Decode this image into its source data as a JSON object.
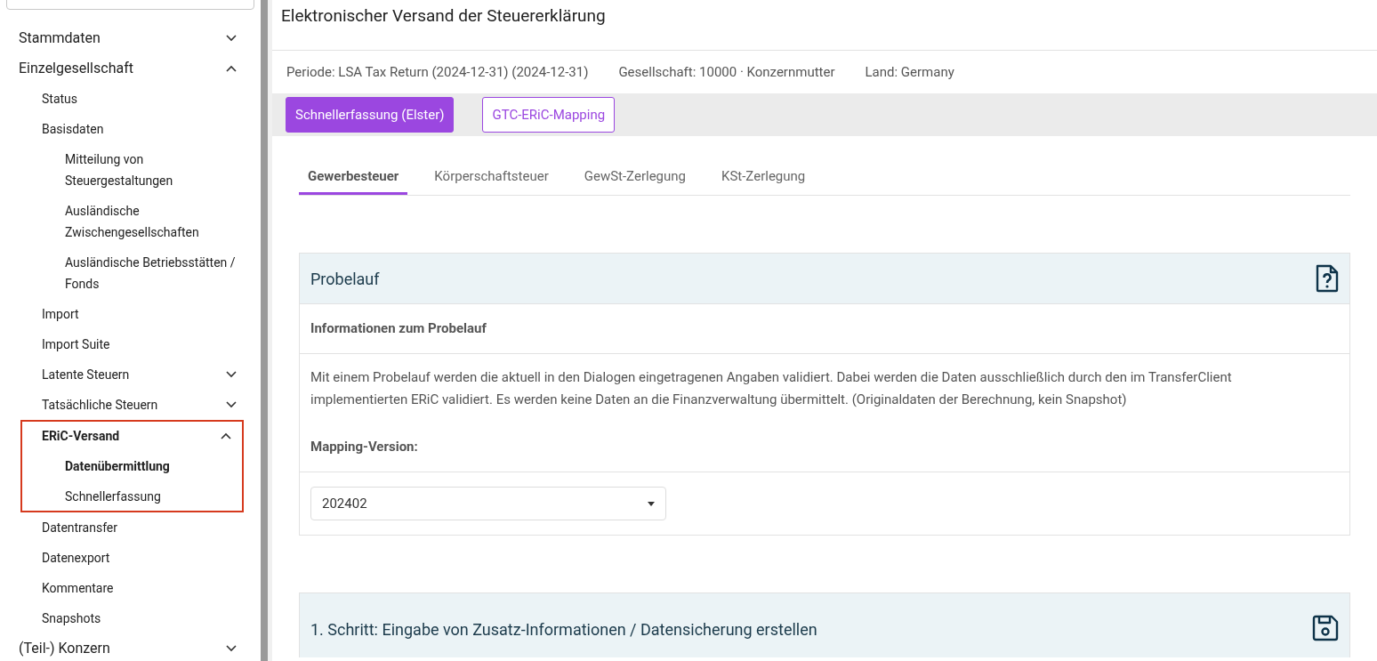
{
  "sidebar": {
    "items": [
      {
        "label": "Stammdaten",
        "expanded": false
      },
      {
        "label": "Einzelgesellschaft",
        "expanded": true,
        "children": [
          {
            "label": "Status"
          },
          {
            "label": "Basisdaten",
            "children": [
              {
                "label": "Mitteilung von Steuergestaltungen"
              },
              {
                "label": "Ausländische Zwischengesellschaften"
              },
              {
                "label": "Ausländische Betriebsstätten / Fonds"
              }
            ]
          },
          {
            "label": "Import"
          },
          {
            "label": "Import Suite"
          },
          {
            "label": "Latente Steuern",
            "expanded": false
          },
          {
            "label": "Tatsächliche Steuern",
            "expanded": false
          },
          {
            "label": "ERiC-Versand",
            "expanded": true,
            "highlighted": true,
            "children": [
              {
                "label": "Datenübermittlung",
                "selected": true
              },
              {
                "label": "Schnellerfassung",
                "selected": false
              }
            ]
          },
          {
            "label": "Datentransfer"
          },
          {
            "label": "Datenexport"
          },
          {
            "label": "Kommentare"
          },
          {
            "label": "Snapshots"
          }
        ]
      },
      {
        "label": "(Teil-) Konzern",
        "expanded": false
      }
    ]
  },
  "page": {
    "title": "Elektronischer Versand der Steuererklärung",
    "info": [
      "Periode: LSA Tax Return (2024-12-31) (2024-12-31)",
      "Gesellschaft: 10000 · Konzernmutter",
      "Land: Germany"
    ],
    "buttons": [
      {
        "label": "Schnellerfassung (Elster)",
        "kind": "primary"
      },
      {
        "label": "GTC-ERiC-Mapping",
        "kind": "outline"
      }
    ],
    "tabs": [
      {
        "label": "Gewerbesteuer",
        "selected": true
      },
      {
        "label": "Körperschaftsteuer",
        "selected": false
      },
      {
        "label": "GewSt-Zerlegung",
        "selected": false
      },
      {
        "label": "KSt-Zerlegung",
        "selected": false
      }
    ],
    "probelauf": {
      "title": "Probelauf",
      "info_heading": "Informationen zum Probelauf",
      "description": "Mit einem Probelauf werden die aktuell in den Dialogen eingetragenen Angaben validiert. Dabei werden die Daten ausschließlich durch den im TransferClient implementierten ERiC validiert. Es werden keine Daten an die Finanzverwaltung übermittelt. (Originaldaten der Berechnung, kein Snapshot)",
      "mapping_label": "Mapping-Version:",
      "mapping_value": "202402"
    },
    "step1": {
      "title": "1. Schritt: Eingabe von Zusatz-Informationen / Datensicherung erstellen"
    }
  }
}
